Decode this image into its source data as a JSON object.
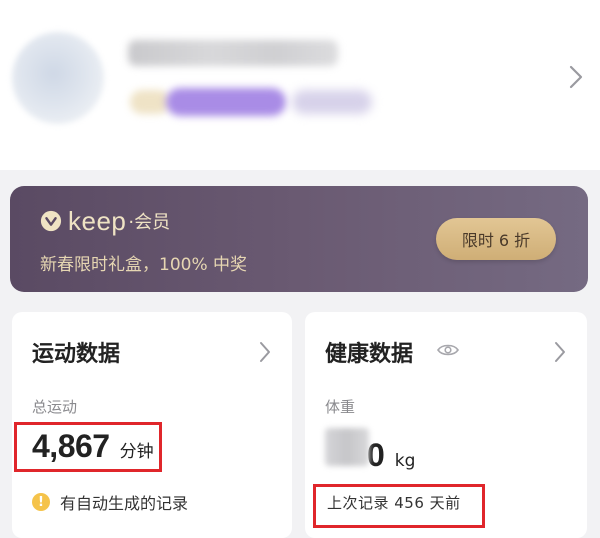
{
  "profile": {
    "avatar": "blurred-avatar",
    "name": "",
    "arrow_icon": "chevron-right-icon"
  },
  "banner": {
    "brand_word": "keep",
    "brand_suffix": "·会员",
    "brand_logo_icon": "keep-heart-logo",
    "promo_text": "新春限时礼盒，100% 中奖",
    "button_label": "限时 6 折",
    "colors": {
      "background": "#5a4a63",
      "accent": "#e2c694"
    }
  },
  "exercise_card": {
    "title": "运动数据",
    "subtitle": "总运动",
    "value": "4,867",
    "unit": "分钟",
    "note": "有自动生成的记录",
    "note_icon": "exclamation-icon"
  },
  "health_card": {
    "title": "健康数据",
    "subtitle": "体重",
    "value_visible_tail": "0",
    "unit": "kg",
    "last_record": "上次记录 456 天前",
    "visibility_icon": "eye-icon"
  },
  "annotations": {
    "highlight_color": "#e0262b"
  }
}
